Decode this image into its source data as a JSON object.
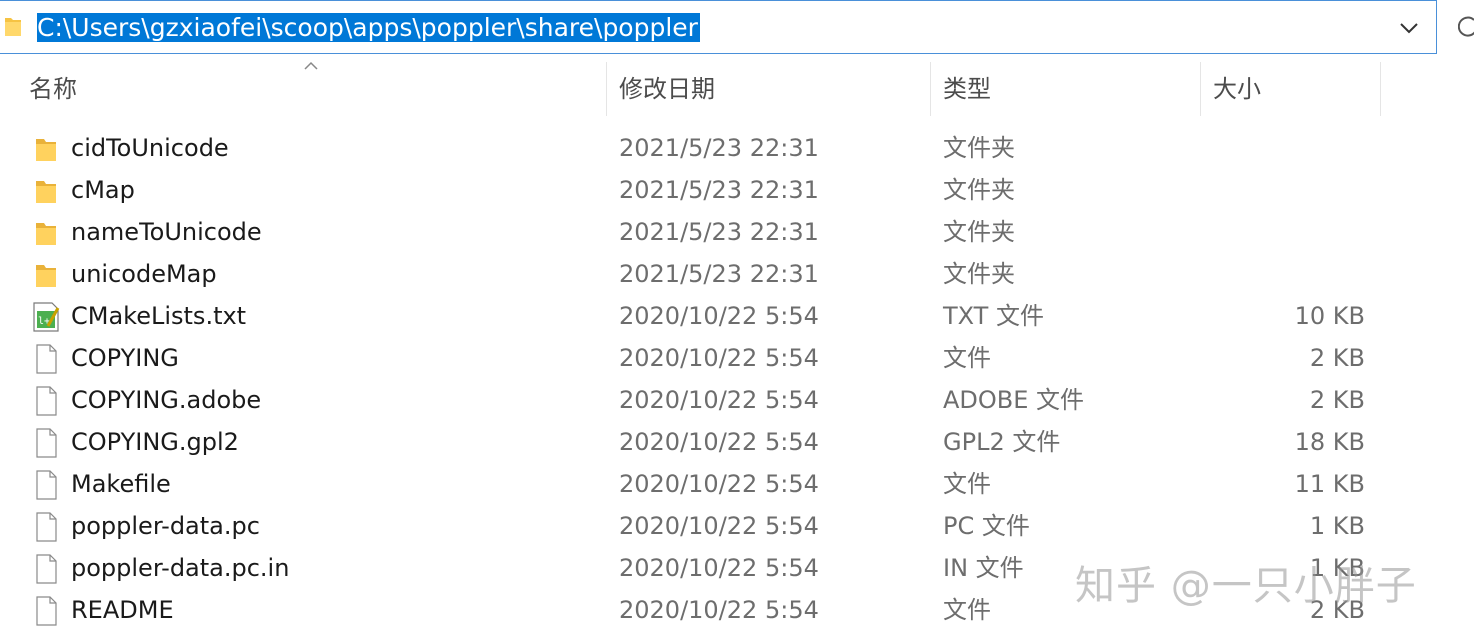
{
  "address_bar": {
    "path": "C:\\Users\\gzxiaofei\\scoop\\apps\\poppler\\share\\poppler"
  },
  "columns": {
    "name": "名称",
    "date": "修改日期",
    "type": "类型",
    "size": "大小"
  },
  "files": [
    {
      "name": "cidToUnicode",
      "date": "2021/5/23 22:31",
      "type": "文件夹",
      "size": "",
      "icon": "folder-icon"
    },
    {
      "name": "cMap",
      "date": "2021/5/23 22:31",
      "type": "文件夹",
      "size": "",
      "icon": "folder-icon"
    },
    {
      "name": "nameToUnicode",
      "date": "2021/5/23 22:31",
      "type": "文件夹",
      "size": "",
      "icon": "folder-icon"
    },
    {
      "name": "unicodeMap",
      "date": "2021/5/23 22:31",
      "type": "文件夹",
      "size": "",
      "icon": "folder-icon"
    },
    {
      "name": "CMakeLists.txt",
      "date": "2020/10/22 5:54",
      "type": "TXT 文件",
      "size": "10 KB",
      "icon": "text-editor-file-icon"
    },
    {
      "name": "COPYING",
      "date": "2020/10/22 5:54",
      "type": "文件",
      "size": "2 KB",
      "icon": "file-icon"
    },
    {
      "name": "COPYING.adobe",
      "date": "2020/10/22 5:54",
      "type": "ADOBE 文件",
      "size": "2 KB",
      "icon": "file-icon"
    },
    {
      "name": "COPYING.gpl2",
      "date": "2020/10/22 5:54",
      "type": "GPL2 文件",
      "size": "18 KB",
      "icon": "file-icon"
    },
    {
      "name": "Makefile",
      "date": "2020/10/22 5:54",
      "type": "文件",
      "size": "11 KB",
      "icon": "file-icon"
    },
    {
      "name": "poppler-data.pc",
      "date": "2020/10/22 5:54",
      "type": "PC 文件",
      "size": "1 KB",
      "icon": "file-icon"
    },
    {
      "name": "poppler-data.pc.in",
      "date": "2020/10/22 5:54",
      "type": "IN 文件",
      "size": "1 KB",
      "icon": "file-icon"
    },
    {
      "name": "README",
      "date": "2020/10/22 5:54",
      "type": "文件",
      "size": "2 KB",
      "icon": "file-icon"
    }
  ],
  "colors": {
    "selection": "#0078d7",
    "folder": "#f6c343",
    "border_accent": "#4a90d9"
  },
  "watermark": "知乎 @一只小胖子"
}
